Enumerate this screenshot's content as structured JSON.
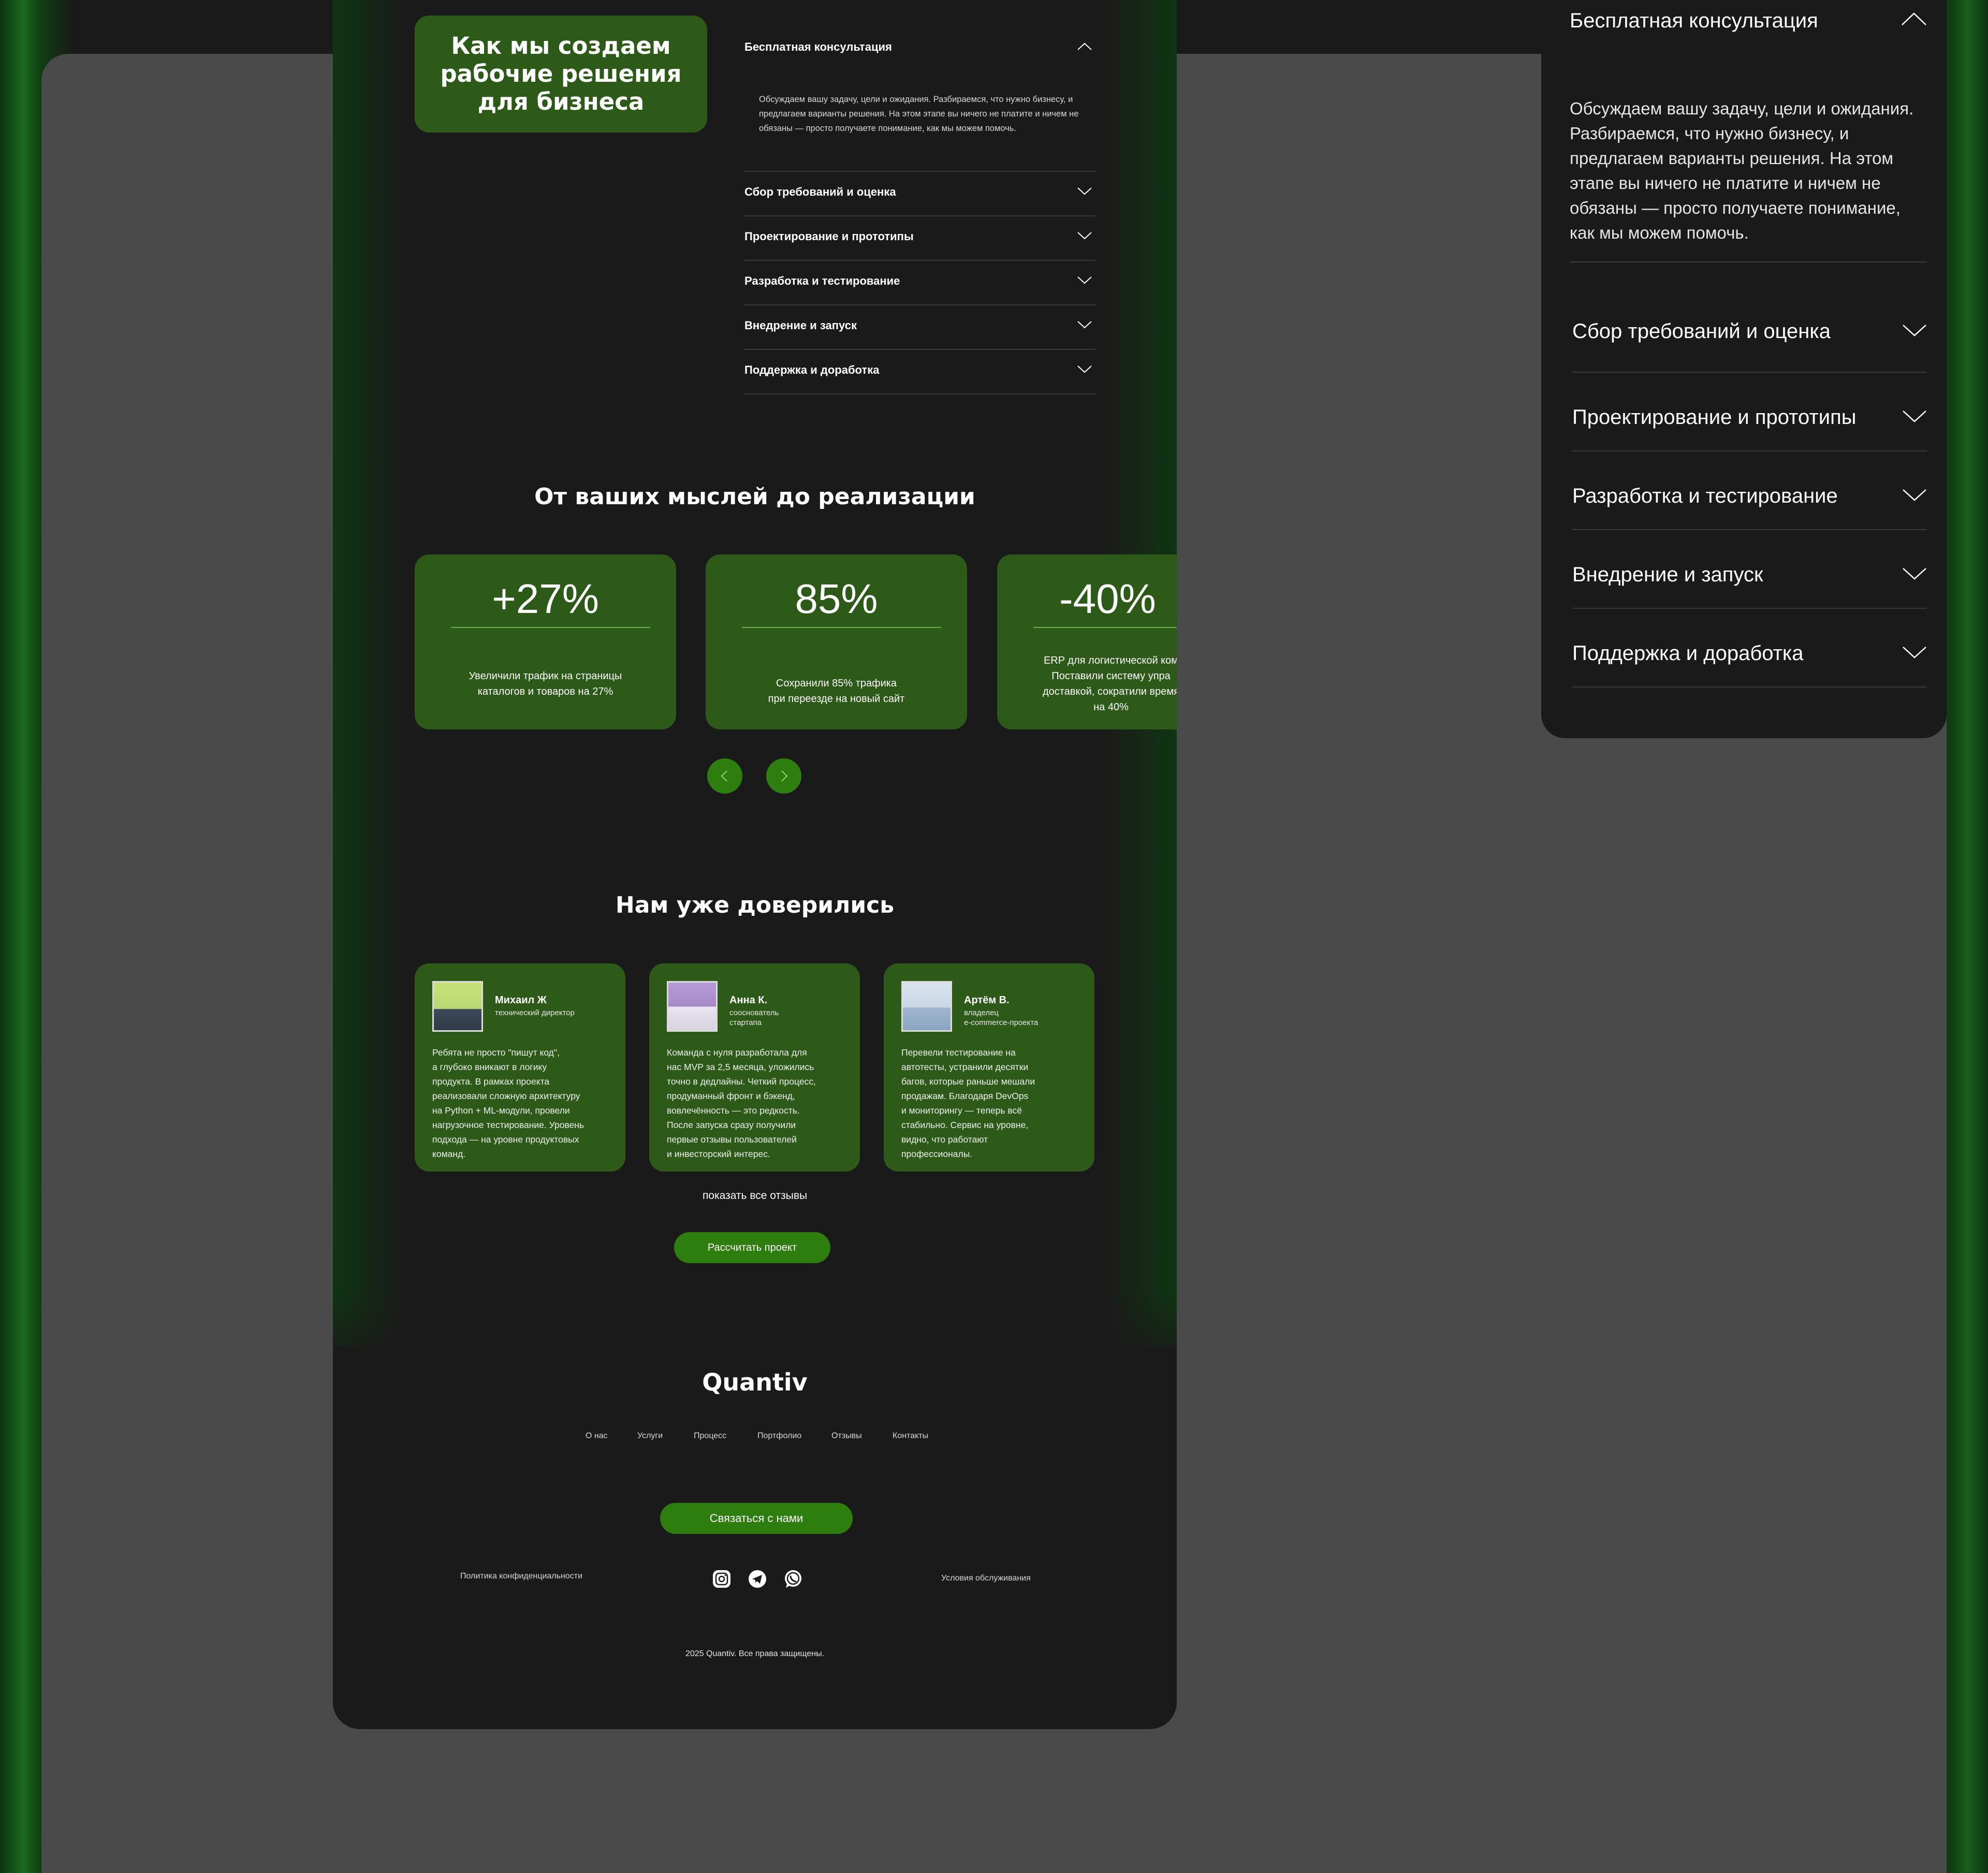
{
  "process": {
    "title": "Как мы создаем рабочие решения для бизнеса",
    "steps": [
      {
        "label": "Бесплатная консультация",
        "expanded": true,
        "description": "Обсуждаем вашу задачу, цели и ожидания. Разбираемся, что нужно бизнесу, и предлагаем варианты решения. На этом этапе вы ничего не платите и ничем не обязаны — просто получаете понимание, как мы можем помочь."
      },
      {
        "label": "Сбор требований и оценка",
        "expanded": false
      },
      {
        "label": "Проектирование и прототипы",
        "expanded": false
      },
      {
        "label": "Разработка и тестирование",
        "expanded": false
      },
      {
        "label": "Внедрение и запуск",
        "expanded": false
      },
      {
        "label": "Поддержка и доработка",
        "expanded": false
      }
    ]
  },
  "results": {
    "title": "От ваших мыслей до реализации",
    "cards": [
      {
        "value": "+27%",
        "description": "Увеличили трафик на страницы\nкаталогов и товаров на 27%"
      },
      {
        "value": "85%",
        "description": "Сохранили 85% трафика\nпри переезде на новый сайт"
      },
      {
        "value": "-40%",
        "description": "ERP для логистической ком\nПоставили систему упра\nдоставкой, сократили время\nна 40%"
      }
    ]
  },
  "reviews": {
    "title": "Нам уже доверились",
    "items": [
      {
        "name": "Михаил Ж",
        "role": "технический директор",
        "text": "Ребята не просто \"пишут код\",\n а глубоко вникают в логику\nпродукта. В рамках проекта\nреализовали сложную архитектуру\nна Python + ML-модули, провели\nнагрузочное тестирование. Уровень\nподхода — на уровне продуктовых\nкоманд."
      },
      {
        "name": "Анна К.",
        "role": "сооснователь\nстартапа",
        "text": "Команда с нуля разработала для\nнас MVP за 2,5 месяца, уложились\nточно в дедлайны. Четкий процесс,\nпродуманный фронт и бэкенд,\nвовлечённость — это редкость.\nПосле запуска сразу получили\nпервые отзывы пользователей\nи инвесторский интерес."
      },
      {
        "name": "Артём В.",
        "role": "владелец\ne-commerce-проекта",
        "text": "Перевели тестирование на\nавтотесты, устранили десятки\nбагов, которые раньше мешали\nпродажам. Благодаря DevOps\nи мониторингу — теперь всё\nстабильно. Сервис на уровне,\nвидно, что работают\nпрофессионалы."
      }
    ],
    "show_all": "показать все отзывы",
    "cta": "Рассчитать проект"
  },
  "footer": {
    "brand": "Quantiv",
    "nav": [
      "О нас",
      "Услуги",
      "Процесс",
      "Портфолио",
      "Отзывы",
      "Контакты"
    ],
    "contact_button": "Связаться с нами",
    "privacy": "Политика конфиденциальности",
    "terms": "Условия обслуживания",
    "social_icons": [
      "instagram-icon",
      "telegram-icon",
      "whatsapp-icon"
    ],
    "copyright": "2025 Quantiv. Все права защищены."
  },
  "colors": {
    "accent_green": "#2d5a18",
    "button_green": "#2e7d0f",
    "background": "#1b1a1a",
    "canvas": "#4a4a4a"
  }
}
